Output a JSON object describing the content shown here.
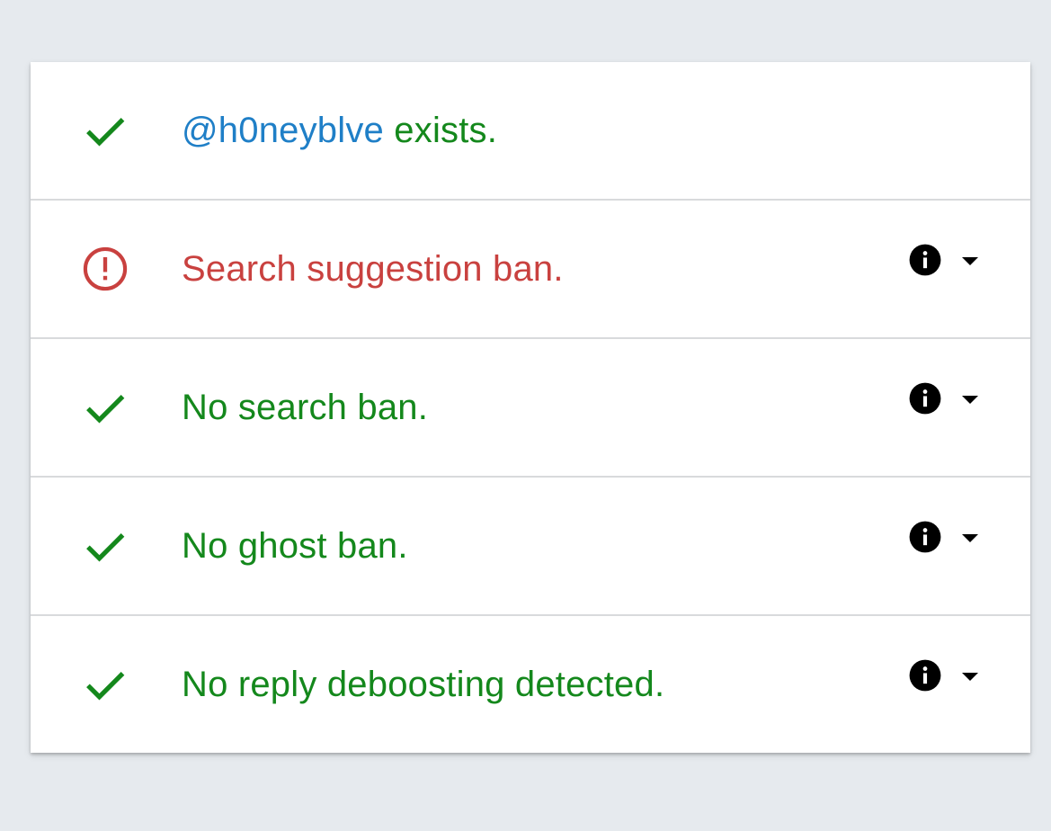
{
  "colors": {
    "ok": "#14881c",
    "bad": "#c9413f",
    "handle": "#1f7fc7",
    "background": "#e6eaee"
  },
  "results": {
    "exists": {
      "status": "ok",
      "icon": "check-icon",
      "handle": "@h0neyblve",
      "text": "exists."
    },
    "search_suggestion": {
      "status": "bad",
      "icon": "alert-circle-icon",
      "text": "Search suggestion ban."
    },
    "search": {
      "status": "ok",
      "icon": "check-icon",
      "text": "No search ban."
    },
    "ghost": {
      "status": "ok",
      "icon": "check-icon",
      "text": "No ghost ban."
    },
    "reply_deboosting": {
      "status": "ok",
      "icon": "check-icon",
      "text": "No reply deboosting detected."
    }
  }
}
